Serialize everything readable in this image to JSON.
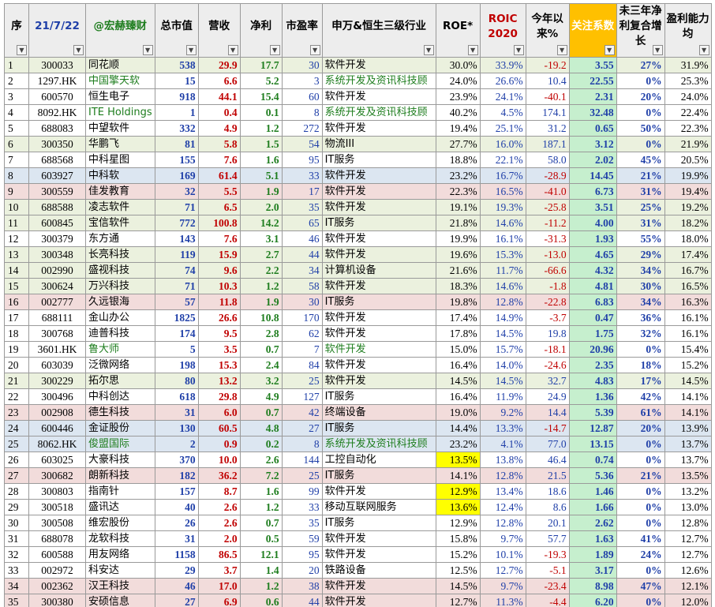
{
  "headers": {
    "seq": "序",
    "date": "21/7/22",
    "brand": "@宏赫臻财",
    "mcap": "总市值",
    "revenue": "营收",
    "net_profit": "净利",
    "pe": "市盈率",
    "industry": "申万&恒生三级行业",
    "roe": "ROE*",
    "roic": "ROIC 2020",
    "ytd": "今年以来%",
    "focus": "关注系数",
    "growth": "未三年净利复合增长",
    "margin": "盈利能力均"
  },
  "colors": {
    "header_bg": "#ededed",
    "focus_header": "#ffc000",
    "focus_cell": "#c6efce",
    "row_green": "#ebf1de",
    "row_pink": "#f2dcdb",
    "row_blue": "#dce6f1",
    "highlight": "#ffff00",
    "blue_text": "#1f3fa8",
    "red_text": "#c00000",
    "green_text": "#1e7d1e"
  },
  "rows": [
    {
      "seq": "1",
      "code": "300033",
      "name": "同花顺",
      "mcap": "538",
      "rev": "29.9",
      "np": "17.7",
      "pe": "30",
      "ind": "软件开发",
      "roe": "30.0%",
      "roic": "33.9%",
      "ytd": "-19.2",
      "focus": "3.55",
      "growth": "27%",
      "margin": "31.9%",
      "bg": "green",
      "hk": false,
      "roeHL": false
    },
    {
      "seq": "2",
      "code": "1297.HK",
      "name": "中国擎天软",
      "mcap": "15",
      "rev": "6.6",
      "np": "5.2",
      "pe": "3",
      "ind": "系统开发及资讯科技顾",
      "roe": "24.0%",
      "roic": "26.6%",
      "ytd": "10.4",
      "focus": "22.55",
      "growth": "0%",
      "margin": "25.3%",
      "bg": "none",
      "hk": true,
      "roeHL": false
    },
    {
      "seq": "3",
      "code": "600570",
      "name": "恒生电子",
      "mcap": "918",
      "rev": "44.1",
      "np": "15.4",
      "pe": "60",
      "ind": "软件开发",
      "roe": "23.9%",
      "roic": "24.1%",
      "ytd": "-40.1",
      "focus": "2.31",
      "growth": "20%",
      "margin": "24.0%",
      "bg": "none",
      "hk": false,
      "roeHL": false
    },
    {
      "seq": "4",
      "code": "8092.HK",
      "name": "ITE Holdings",
      "mcap": "1",
      "rev": "0.4",
      "np": "0.1",
      "pe": "8",
      "ind": "系统开发及资讯科技顾",
      "roe": "40.2%",
      "roic": "4.5%",
      "ytd": "174.1",
      "focus": "32.48",
      "growth": "0%",
      "margin": "22.4%",
      "bg": "none",
      "hk": true,
      "roeHL": false
    },
    {
      "seq": "5",
      "code": "688083",
      "name": "中望软件",
      "mcap": "332",
      "rev": "4.9",
      "np": "1.2",
      "pe": "272",
      "ind": "软件开发",
      "roe": "19.4%",
      "roic": "25.1%",
      "ytd": "31.2",
      "focus": "0.65",
      "growth": "50%",
      "margin": "22.3%",
      "bg": "none",
      "hk": false,
      "roeHL": false
    },
    {
      "seq": "6",
      "code": "300350",
      "name": "华鹏飞",
      "mcap": "81",
      "rev": "5.8",
      "np": "1.5",
      "pe": "54",
      "ind": "物流III",
      "roe": "27.7%",
      "roic": "16.0%",
      "ytd": "187.1",
      "focus": "3.12",
      "growth": "0%",
      "margin": "21.9%",
      "bg": "green",
      "hk": false,
      "roeHL": false
    },
    {
      "seq": "7",
      "code": "688568",
      "name": "中科星图",
      "mcap": "155",
      "rev": "7.6",
      "np": "1.6",
      "pe": "95",
      "ind": "IT服务",
      "roe": "18.8%",
      "roic": "22.1%",
      "ytd": "58.0",
      "focus": "2.02",
      "growth": "45%",
      "margin": "20.5%",
      "bg": "none",
      "hk": false,
      "roeHL": false
    },
    {
      "seq": "8",
      "code": "603927",
      "name": "中科软",
      "mcap": "169",
      "rev": "61.4",
      "np": "5.1",
      "pe": "33",
      "ind": "软件开发",
      "roe": "23.2%",
      "roic": "16.7%",
      "ytd": "-28.9",
      "focus": "14.45",
      "growth": "21%",
      "margin": "19.9%",
      "bg": "blue",
      "hk": false,
      "roeHL": false
    },
    {
      "seq": "9",
      "code": "300559",
      "name": "佳发教育",
      "mcap": "32",
      "rev": "5.5",
      "np": "1.9",
      "pe": "17",
      "ind": "软件开发",
      "roe": "22.3%",
      "roic": "16.5%",
      "ytd": "-41.0",
      "focus": "6.73",
      "growth": "31%",
      "margin": "19.4%",
      "bg": "pink",
      "hk": false,
      "roeHL": false
    },
    {
      "seq": "10",
      "code": "688588",
      "name": "凌志软件",
      "mcap": "71",
      "rev": "6.5",
      "np": "2.0",
      "pe": "35",
      "ind": "软件开发",
      "roe": "19.1%",
      "roic": "19.3%",
      "ytd": "-25.8",
      "focus": "3.51",
      "growth": "25%",
      "margin": "19.2%",
      "bg": "green",
      "hk": false,
      "roeHL": false
    },
    {
      "seq": "11",
      "code": "600845",
      "name": "宝信软件",
      "mcap": "772",
      "rev": "100.8",
      "np": "14.2",
      "pe": "65",
      "ind": "IT服务",
      "roe": "21.8%",
      "roic": "14.6%",
      "ytd": "-11.2",
      "focus": "4.00",
      "growth": "31%",
      "margin": "18.2%",
      "bg": "green",
      "hk": false,
      "roeHL": false
    },
    {
      "seq": "12",
      "code": "300379",
      "name": "东方通",
      "mcap": "143",
      "rev": "7.6",
      "np": "3.1",
      "pe": "46",
      "ind": "软件开发",
      "roe": "19.9%",
      "roic": "16.1%",
      "ytd": "-31.3",
      "focus": "1.93",
      "growth": "55%",
      "margin": "18.0%",
      "bg": "none",
      "hk": false,
      "roeHL": false
    },
    {
      "seq": "13",
      "code": "300348",
      "name": "长亮科技",
      "mcap": "119",
      "rev": "15.9",
      "np": "2.7",
      "pe": "44",
      "ind": "软件开发",
      "roe": "19.6%",
      "roic": "15.3%",
      "ytd": "-13.0",
      "focus": "4.65",
      "growth": "29%",
      "margin": "17.4%",
      "bg": "green",
      "hk": false,
      "roeHL": false
    },
    {
      "seq": "14",
      "code": "002990",
      "name": "盛视科技",
      "mcap": "74",
      "rev": "9.6",
      "np": "2.2",
      "pe": "34",
      "ind": "计算机设备",
      "roe": "21.6%",
      "roic": "11.7%",
      "ytd": "-66.6",
      "focus": "4.32",
      "growth": "34%",
      "margin": "16.7%",
      "bg": "green",
      "hk": false,
      "roeHL": false
    },
    {
      "seq": "15",
      "code": "300624",
      "name": "万兴科技",
      "mcap": "71",
      "rev": "10.3",
      "np": "1.2",
      "pe": "58",
      "ind": "软件开发",
      "roe": "18.3%",
      "roic": "14.6%",
      "ytd": "-1.8",
      "focus": "4.81",
      "growth": "30%",
      "margin": "16.5%",
      "bg": "green",
      "hk": false,
      "roeHL": false
    },
    {
      "seq": "16",
      "code": "002777",
      "name": "久远银海",
      "mcap": "57",
      "rev": "11.8",
      "np": "1.9",
      "pe": "30",
      "ind": "IT服务",
      "roe": "19.8%",
      "roic": "12.8%",
      "ytd": "-22.8",
      "focus": "6.83",
      "growth": "34%",
      "margin": "16.3%",
      "bg": "pink",
      "hk": false,
      "roeHL": false
    },
    {
      "seq": "17",
      "code": "688111",
      "name": "金山办公",
      "mcap": "1825",
      "rev": "26.6",
      "np": "10.8",
      "pe": "170",
      "ind": "软件开发",
      "roe": "17.4%",
      "roic": "14.9%",
      "ytd": "-3.7",
      "focus": "0.47",
      "growth": "36%",
      "margin": "16.1%",
      "bg": "none",
      "hk": false,
      "roeHL": false
    },
    {
      "seq": "18",
      "code": "300768",
      "name": "迪普科技",
      "mcap": "174",
      "rev": "9.5",
      "np": "2.8",
      "pe": "62",
      "ind": "软件开发",
      "roe": "17.8%",
      "roic": "14.5%",
      "ytd": "19.8",
      "focus": "1.75",
      "growth": "32%",
      "margin": "16.1%",
      "bg": "none",
      "hk": false,
      "roeHL": false
    },
    {
      "seq": "19",
      "code": "3601.HK",
      "name": "鲁大师",
      "mcap": "5",
      "rev": "3.5",
      "np": "0.7",
      "pe": "7",
      "ind": "软件开发",
      "roe": "15.0%",
      "roic": "15.7%",
      "ytd": "-18.1",
      "focus": "20.96",
      "growth": "0%",
      "margin": "15.4%",
      "bg": "none",
      "hk": true,
      "roeHL": false
    },
    {
      "seq": "20",
      "code": "603039",
      "name": "泛微网络",
      "mcap": "198",
      "rev": "15.3",
      "np": "2.4",
      "pe": "84",
      "ind": "软件开发",
      "roe": "16.4%",
      "roic": "14.0%",
      "ytd": "-24.6",
      "focus": "2.35",
      "growth": "18%",
      "margin": "15.2%",
      "bg": "none",
      "hk": false,
      "roeHL": false
    },
    {
      "seq": "21",
      "code": "300229",
      "name": "拓尔思",
      "mcap": "80",
      "rev": "13.2",
      "np": "3.2",
      "pe": "25",
      "ind": "软件开发",
      "roe": "14.5%",
      "roic": "14.5%",
      "ytd": "32.7",
      "focus": "4.83",
      "growth": "17%",
      "margin": "14.5%",
      "bg": "green",
      "hk": false,
      "roeHL": false
    },
    {
      "seq": "22",
      "code": "300496",
      "name": "中科创达",
      "mcap": "618",
      "rev": "29.8",
      "np": "4.9",
      "pe": "127",
      "ind": "IT服务",
      "roe": "16.4%",
      "roic": "11.9%",
      "ytd": "24.9",
      "focus": "1.36",
      "growth": "42%",
      "margin": "14.1%",
      "bg": "none",
      "hk": false,
      "roeHL": false
    },
    {
      "seq": "23",
      "code": "002908",
      "name": "德生科技",
      "mcap": "31",
      "rev": "6.0",
      "np": "0.7",
      "pe": "42",
      "ind": "终端设备",
      "roe": "19.0%",
      "roic": "9.2%",
      "ytd": "14.4",
      "focus": "5.39",
      "growth": "61%",
      "margin": "14.1%",
      "bg": "pink",
      "hk": false,
      "roeHL": false
    },
    {
      "seq": "24",
      "code": "600446",
      "name": "金证股份",
      "mcap": "130",
      "rev": "60.5",
      "np": "4.8",
      "pe": "27",
      "ind": "IT服务",
      "roe": "14.4%",
      "roic": "13.3%",
      "ytd": "-14.7",
      "focus": "12.87",
      "growth": "20%",
      "margin": "13.9%",
      "bg": "blue",
      "hk": false,
      "roeHL": false
    },
    {
      "seq": "25",
      "code": "8062.HK",
      "name": "俊盟国际",
      "mcap": "2",
      "rev": "0.9",
      "np": "0.2",
      "pe": "8",
      "ind": "系统开发及资讯科技顾",
      "roe": "23.2%",
      "roic": "4.1%",
      "ytd": "77.0",
      "focus": "13.15",
      "growth": "0%",
      "margin": "13.7%",
      "bg": "blue",
      "hk": true,
      "roeHL": false
    },
    {
      "seq": "26",
      "code": "603025",
      "name": "大豪科技",
      "mcap": "370",
      "rev": "10.0",
      "np": "2.6",
      "pe": "144",
      "ind": "工控自动化",
      "roe": "13.5%",
      "roic": "13.8%",
      "ytd": "46.4",
      "focus": "0.74",
      "growth": "0%",
      "margin": "13.7%",
      "bg": "none",
      "hk": false,
      "roeHL": true
    },
    {
      "seq": "27",
      "code": "300682",
      "name": "朗新科技",
      "mcap": "182",
      "rev": "36.2",
      "np": "7.2",
      "pe": "25",
      "ind": "IT服务",
      "roe": "14.1%",
      "roic": "12.8%",
      "ytd": "21.5",
      "focus": "5.36",
      "growth": "21%",
      "margin": "13.5%",
      "bg": "pink",
      "hk": false,
      "roeHL": false
    },
    {
      "seq": "28",
      "code": "300803",
      "name": "指南针",
      "mcap": "157",
      "rev": "8.7",
      "np": "1.6",
      "pe": "99",
      "ind": "软件开发",
      "roe": "12.9%",
      "roic": "13.4%",
      "ytd": "18.6",
      "focus": "1.46",
      "growth": "0%",
      "margin": "13.2%",
      "bg": "none",
      "hk": false,
      "roeHL": true
    },
    {
      "seq": "29",
      "code": "300518",
      "name": "盛讯达",
      "mcap": "40",
      "rev": "2.6",
      "np": "1.2",
      "pe": "33",
      "ind": "移动互联网服务",
      "roe": "13.6%",
      "roic": "12.4%",
      "ytd": "8.6",
      "focus": "1.66",
      "growth": "0%",
      "margin": "13.0%",
      "bg": "none",
      "hk": false,
      "roeHL": true
    },
    {
      "seq": "30",
      "code": "300508",
      "name": "维宏股份",
      "mcap": "26",
      "rev": "2.6",
      "np": "0.7",
      "pe": "35",
      "ind": "IT服务",
      "roe": "12.9%",
      "roic": "12.8%",
      "ytd": "20.1",
      "focus": "2.62",
      "growth": "0%",
      "margin": "12.8%",
      "bg": "none",
      "hk": false,
      "roeHL": false
    },
    {
      "seq": "31",
      "code": "688078",
      "name": "龙软科技",
      "mcap": "31",
      "rev": "2.0",
      "np": "0.5",
      "pe": "59",
      "ind": "软件开发",
      "roe": "15.8%",
      "roic": "9.7%",
      "ytd": "57.7",
      "focus": "1.63",
      "growth": "41%",
      "margin": "12.7%",
      "bg": "none",
      "hk": false,
      "roeHL": false
    },
    {
      "seq": "32",
      "code": "600588",
      "name": "用友网络",
      "mcap": "1158",
      "rev": "86.5",
      "np": "12.1",
      "pe": "95",
      "ind": "软件开发",
      "roe": "15.2%",
      "roic": "10.1%",
      "ytd": "-19.3",
      "focus": "1.89",
      "growth": "24%",
      "margin": "12.7%",
      "bg": "none",
      "hk": false,
      "roeHL": false
    },
    {
      "seq": "33",
      "code": "002972",
      "name": "科安达",
      "mcap": "29",
      "rev": "3.7",
      "np": "1.4",
      "pe": "20",
      "ind": "铁路设备",
      "roe": "12.5%",
      "roic": "12.7%",
      "ytd": "-5.1",
      "focus": "3.17",
      "growth": "0%",
      "margin": "12.6%",
      "bg": "none",
      "hk": false,
      "roeHL": false
    },
    {
      "seq": "34",
      "code": "002362",
      "name": "汉王科技",
      "mcap": "46",
      "rev": "17.0",
      "np": "1.2",
      "pe": "38",
      "ind": "软件开发",
      "roe": "14.5%",
      "roic": "9.7%",
      "ytd": "-23.4",
      "focus": "8.98",
      "growth": "47%",
      "margin": "12.1%",
      "bg": "pink",
      "hk": false,
      "roeHL": false
    },
    {
      "seq": "35",
      "code": "300380",
      "name": "安硕信息",
      "mcap": "27",
      "rev": "6.9",
      "np": "0.6",
      "pe": "44",
      "ind": "软件开发",
      "roe": "12.7%",
      "roic": "11.3%",
      "ytd": "-4.4",
      "focus": "6.20",
      "growth": "0%",
      "margin": "12.0%",
      "bg": "pink",
      "hk": false,
      "roeHL": false
    }
  ]
}
